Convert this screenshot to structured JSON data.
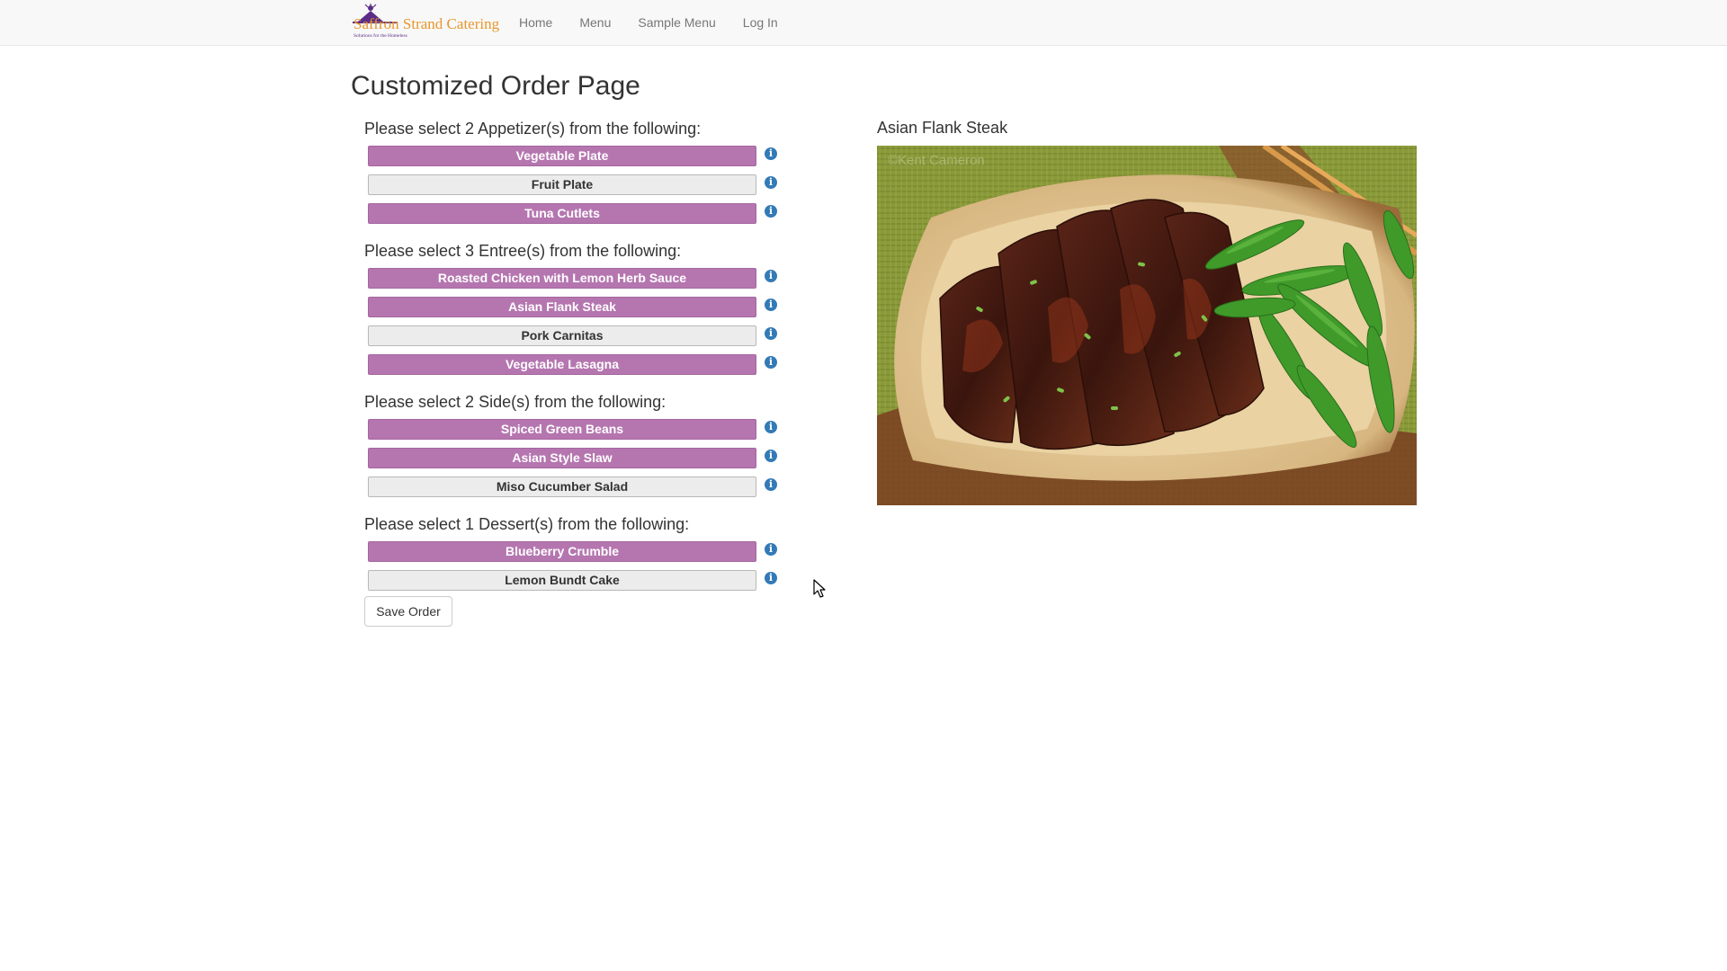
{
  "brand": {
    "name": "Saffron Strand Catering",
    "tagline": "Solutions for the Homeless"
  },
  "nav": {
    "items": [
      {
        "label": "Home"
      },
      {
        "label": "Menu"
      },
      {
        "label": "Sample Menu"
      },
      {
        "label": "Log In"
      }
    ]
  },
  "page": {
    "title": "Customized Order Page"
  },
  "categories": [
    {
      "heading": "Please select 2 Appetizer(s) from the following:",
      "items": [
        {
          "label": "Vegetable Plate",
          "selected": true
        },
        {
          "label": "Fruit Plate",
          "selected": false
        },
        {
          "label": "Tuna Cutlets",
          "selected": true
        }
      ]
    },
    {
      "heading": "Please select 3 Entree(s) from the following:",
      "items": [
        {
          "label": "Roasted Chicken with Lemon Herb Sauce",
          "selected": true
        },
        {
          "label": "Asian Flank Steak",
          "selected": true
        },
        {
          "label": "Pork Carnitas",
          "selected": false
        },
        {
          "label": "Vegetable Lasagna",
          "selected": true
        }
      ]
    },
    {
      "heading": "Please select 2 Side(s) from the following:",
      "items": [
        {
          "label": "Spiced Green Beans",
          "selected": true
        },
        {
          "label": "Asian Style Slaw",
          "selected": true
        },
        {
          "label": "Miso Cucumber Salad",
          "selected": false
        }
      ]
    },
    {
      "heading": "Please select 1 Dessert(s) from the following:",
      "items": [
        {
          "label": "Blueberry Crumble",
          "selected": true
        },
        {
          "label": "Lemon Bundt Cake",
          "selected": false
        }
      ]
    }
  ],
  "actions": {
    "save_label": "Save Order"
  },
  "preview": {
    "title": "Asian Flank Steak",
    "watermark": "©Kent Cameron"
  },
  "icons": {
    "info": "info-icon",
    "info_glyph": "i"
  },
  "colors": {
    "selected": "#b576b0",
    "unselected": "#ececec",
    "info": "#337ab7"
  }
}
